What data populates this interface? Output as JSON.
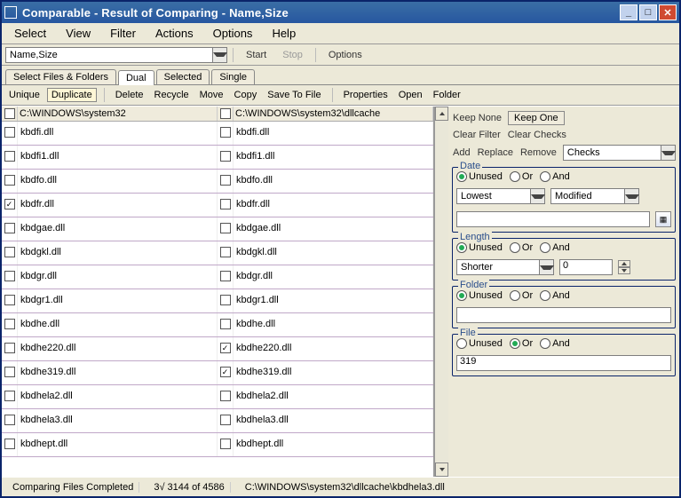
{
  "titlebar": {
    "title": "Comparable - Result of Comparing - Name,Size"
  },
  "menubar": {
    "items": [
      "Select",
      "View",
      "Filter",
      "Actions",
      "Options",
      "Help"
    ]
  },
  "toolbar1": {
    "compare_by": "Name,Size",
    "start": "Start",
    "stop": "Stop",
    "options": "Options"
  },
  "tabs": {
    "items": [
      "Select Files & Folders",
      "Dual",
      "Selected",
      "Single"
    ],
    "active": 1
  },
  "toolbar2": {
    "groupA": [
      "Unique",
      "Duplicate"
    ],
    "active": 1,
    "groupB": [
      "Delete",
      "Recycle",
      "Move",
      "Copy",
      "Save To File"
    ],
    "groupC": [
      "Properties",
      "Open",
      "Folder"
    ]
  },
  "list": {
    "headers": {
      "left": "C:\\WINDOWS\\system32",
      "right": "C:\\WINDOWS\\system32\\dllcache"
    },
    "rows": [
      {
        "lck": false,
        "l": "kbdfi.dll",
        "rck": false,
        "r": "kbdfi.dll"
      },
      {
        "lck": false,
        "l": "kbdfi1.dll",
        "rck": false,
        "r": "kbdfi1.dll"
      },
      {
        "lck": false,
        "l": "kbdfo.dll",
        "rck": false,
        "r": "kbdfo.dll"
      },
      {
        "lck": true,
        "l": "kbdfr.dll",
        "rck": false,
        "r": "kbdfr.dll"
      },
      {
        "lck": false,
        "l": "kbdgae.dll",
        "rck": false,
        "r": "kbdgae.dll"
      },
      {
        "lck": false,
        "l": "kbdgkl.dll",
        "rck": false,
        "r": "kbdgkl.dll"
      },
      {
        "lck": false,
        "l": "kbdgr.dll",
        "rck": false,
        "r": "kbdgr.dll"
      },
      {
        "lck": false,
        "l": "kbdgr1.dll",
        "rck": false,
        "r": "kbdgr1.dll"
      },
      {
        "lck": false,
        "l": "kbdhe.dll",
        "rck": false,
        "r": "kbdhe.dll"
      },
      {
        "lck": false,
        "l": "kbdhe220.dll",
        "rck": true,
        "r": "kbdhe220.dll"
      },
      {
        "lck": false,
        "l": "kbdhe319.dll",
        "rck": true,
        "r": "kbdhe319.dll"
      },
      {
        "lck": false,
        "l": "kbdhela2.dll",
        "rck": false,
        "r": "kbdhela2.dll"
      },
      {
        "lck": false,
        "l": "kbdhela3.dll",
        "rck": false,
        "r": "kbdhela3.dll"
      },
      {
        "lck": false,
        "l": "kbdhept.dll",
        "rck": false,
        "r": "kbdhept.dll"
      }
    ]
  },
  "rightpane": {
    "keep_none": "Keep None",
    "keep_one": "Keep One",
    "clear_filter": "Clear Filter",
    "clear_checks": "Clear Checks",
    "add": "Add",
    "replace": "Replace",
    "remove": "Remove",
    "checks_combo": "Checks",
    "date": {
      "label": "Date",
      "radios": {
        "unused": "Unused",
        "or": "Or",
        "and": "And",
        "selected": "unused"
      },
      "extent": "Lowest",
      "field": "Modified",
      "value": "",
      "cal": "▦"
    },
    "length": {
      "label": "Length",
      "radios": {
        "unused": "Unused",
        "or": "Or",
        "and": "And",
        "selected": "unused"
      },
      "type": "Shorter",
      "value": "0"
    },
    "folder": {
      "label": "Folder",
      "radios": {
        "unused": "Unused",
        "or": "Or",
        "and": "And",
        "selected": "unused"
      },
      "value": ""
    },
    "file": {
      "label": "File",
      "radios": {
        "unused": "Unused",
        "or": "Or",
        "and": "And",
        "selected": "or"
      },
      "value": "319"
    }
  },
  "status": {
    "p1": "Comparing Files Completed",
    "p2": "3√ 3144 of 4586",
    "p3": "C:\\WINDOWS\\system32\\dllcache\\kbdhela3.dll"
  }
}
